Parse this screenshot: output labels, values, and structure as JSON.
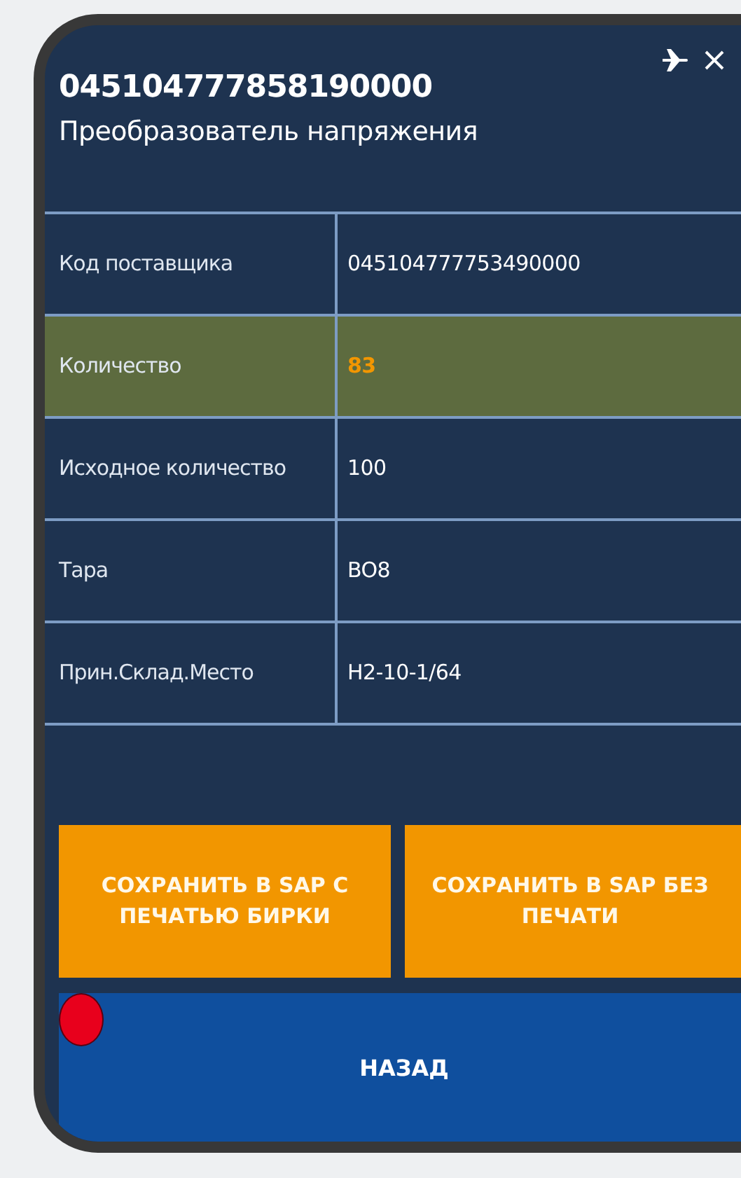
{
  "header": {
    "title": "045104777858190000",
    "subtitle": "Преобразователь напряжения",
    "airplane_mode": true
  },
  "fields": [
    {
      "label": "Код поставщика",
      "value": "045104777753490000",
      "highlighted": false
    },
    {
      "label": "Количество",
      "value": "83",
      "highlighted": true
    },
    {
      "label": "Исходное количество",
      "value": "100",
      "highlighted": false
    },
    {
      "label": "Тара",
      "value": "BO8",
      "highlighted": false
    },
    {
      "label": "Прин.Склад.Место",
      "value": "H2-10-1/64",
      "highlighted": false
    }
  ],
  "actions": [
    {
      "label": "СОХРАНИТЬ В SAP С ПЕЧАТЬЮ БИРКИ",
      "kind": "save"
    },
    {
      "label": "СОХРАНИТЬ В SAP БЕЗ ПЕЧАТИ",
      "kind": "save"
    },
    {
      "label": "НАЗАД",
      "kind": "back"
    }
  ]
}
